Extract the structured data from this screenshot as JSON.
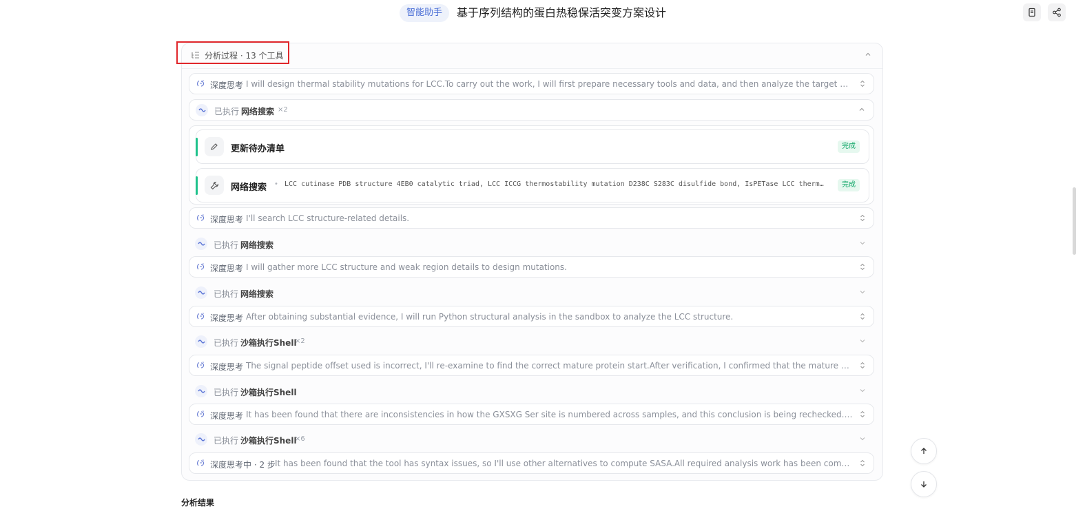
{
  "header": {
    "badge": "智能助手",
    "title": "基于序列结构的蛋白热稳保活突变方案设计",
    "buttons": [
      "document-icon",
      "share-icon"
    ]
  },
  "panel": {
    "header_label": "分析过程 · 13 个工具",
    "steps": [
      {
        "kind": "深度思考",
        "text": "I will design thermal stability mutations for LCC.To carry out the work, I will first prepare necessary tools and data, and then analyze the target enzyme's structure t..."
      },
      {
        "status": "已执行",
        "tool": "网络搜索",
        "count": "×2"
      },
      {
        "kind": "深度思考",
        "text": "I'll search LCC structure-related details."
      },
      {
        "status": "已执行",
        "tool": "网络搜索"
      },
      {
        "kind": "深度思考",
        "text": "I will gather more LCC structure and weak region details to design mutations."
      },
      {
        "status": "已执行",
        "tool": "网络搜索"
      },
      {
        "kind": "深度思考",
        "text": "After obtaining substantial evidence, I will run Python structural analysis in the sandbox to analyze the LCC structure."
      },
      {
        "status": "已执行",
        "tool": "沙箱执行Shell",
        "count": "×2"
      },
      {
        "kind": "深度思考",
        "text": "The signal peptide offset used is incorrect, I'll re-examine to find the correct mature protein start.After verification, I confirmed that the mature LCC protein starts ..."
      },
      {
        "status": "已执行",
        "tool": "沙箱执行Shell"
      },
      {
        "kind": "深度思考",
        "text": "It has been found that there are inconsistencies in how the GXSXG Ser site is numbered across samples, and this conclusion is being rechecked.It has been confir..."
      },
      {
        "status": "已执行",
        "tool": "沙箱执行Shell",
        "count": "×6"
      },
      {
        "kind": "深度思考中 · 2 步",
        "text": "It has been found that the tool has syntax issues, so I'll use other alternatives to compute SASA.All required analysis work has been completed, with suffici..."
      }
    ],
    "expanded_tools": [
      {
        "name": "更新待办清单",
        "status": "完成"
      },
      {
        "name": "网络搜索",
        "query": "LCC cutinase PDB structure 4EB0 catalytic triad, LCC ICCG thermostability mutation D238C S283C disulfide bond, IsPETase LCC therm…",
        "status": "完成"
      }
    ]
  },
  "result_title": "分析结果",
  "colors": {
    "accent": "#4b6fd6",
    "success": "#13a86a",
    "highlight": "#e0262b"
  }
}
